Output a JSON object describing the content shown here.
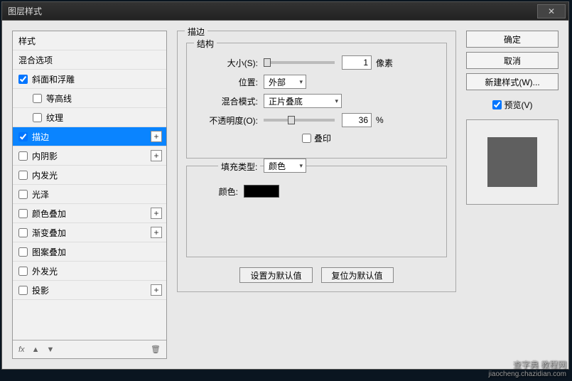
{
  "title": "图层样式",
  "sidebar": {
    "items": [
      {
        "label": "样式",
        "header": true
      },
      {
        "label": "混合选项",
        "header": true
      },
      {
        "label": "斜面和浮雕",
        "checked": true,
        "plus": false
      },
      {
        "label": "等高线",
        "checked": false,
        "indent": true
      },
      {
        "label": "纹理",
        "checked": false,
        "indent": true
      },
      {
        "label": "描边",
        "checked": true,
        "plus": true,
        "selected": true
      },
      {
        "label": "内阴影",
        "checked": false,
        "plus": true
      },
      {
        "label": "内发光",
        "checked": false
      },
      {
        "label": "光泽",
        "checked": false
      },
      {
        "label": "颜色叠加",
        "checked": false,
        "plus": true
      },
      {
        "label": "渐变叠加",
        "checked": false,
        "plus": true
      },
      {
        "label": "图案叠加",
        "checked": false
      },
      {
        "label": "外发光",
        "checked": false
      },
      {
        "label": "投影",
        "checked": false,
        "plus": true
      }
    ],
    "footer_fx": "fx"
  },
  "stroke": {
    "section_title": "描边",
    "structure_title": "结构",
    "size_label": "大小(S):",
    "size_value": "1",
    "size_unit": "像素",
    "position_label": "位置:",
    "position_value": "外部",
    "blend_label": "混合模式:",
    "blend_value": "正片叠底",
    "opacity_label": "不透明度(O):",
    "opacity_value": "36",
    "opacity_unit": "%",
    "overprint_label": "叠印",
    "fill_type_label": "填充类型:",
    "fill_type_value": "颜色",
    "color_label": "颜色:",
    "color_value": "#000000",
    "btn_default": "设置为默认值",
    "btn_reset": "复位为默认值"
  },
  "right": {
    "ok": "确定",
    "cancel": "取消",
    "new_style": "新建样式(W)...",
    "preview_label": "预览(V)",
    "preview_checked": true
  },
  "watermark": {
    "main": "查字典  教程网",
    "sub": "jiaocheng.chazidian.com"
  }
}
